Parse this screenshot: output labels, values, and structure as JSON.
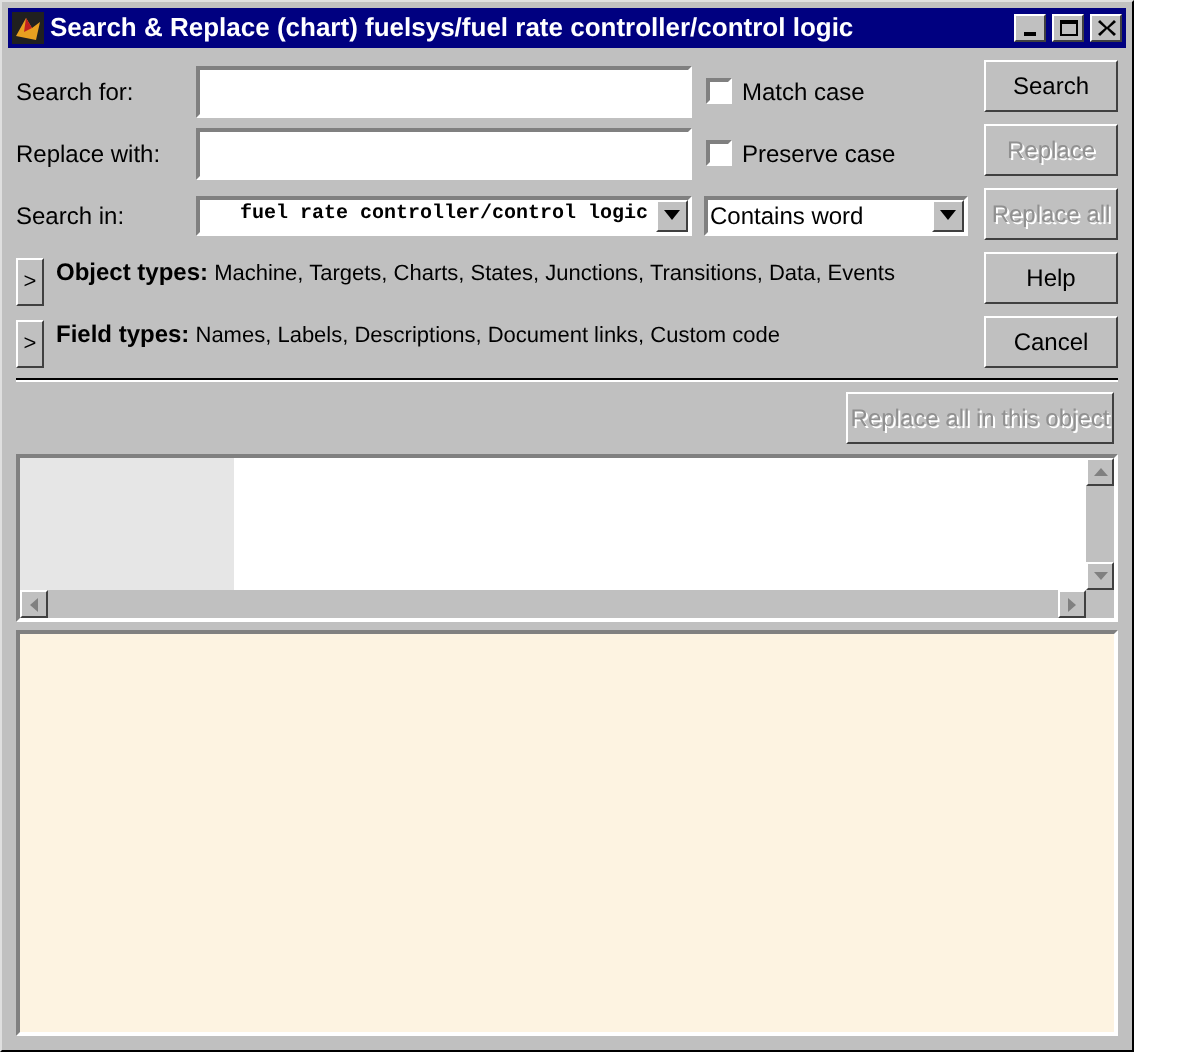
{
  "window": {
    "title": "Search & Replace (chart) fuelsys/fuel rate controller/control logic"
  },
  "fields": [
    {
      "label": "Search for:"
    },
    {
      "label": "Replace with:"
    }
  ],
  "checkboxes": [
    {
      "label": "Match case",
      "checked": false
    },
    {
      "label": "Preserve case",
      "checked": false
    }
  ],
  "search_in": {
    "label": "Search in:",
    "value": "fuel rate controller/control logic"
  },
  "match_mode": {
    "value": "Contains word"
  },
  "buttons": [
    {
      "label": "Search",
      "disabled": false
    },
    {
      "label": "Replace",
      "disabled": true
    },
    {
      "label": "Replace all",
      "disabled": true
    },
    {
      "label": "Help",
      "disabled": false
    },
    {
      "label": "Cancel",
      "disabled": false
    }
  ],
  "type_rows": [
    {
      "expander": ">",
      "label": "Object types:",
      "value": "Machine, Targets, Charts, States, Junctions, Transitions, Data, Events"
    },
    {
      "expander": ">",
      "label": "Field types:",
      "value": "Names, Labels, Descriptions, Document links, Custom code"
    }
  ],
  "replace_object_button": {
    "label": "Replace all in this object",
    "disabled": true
  }
}
